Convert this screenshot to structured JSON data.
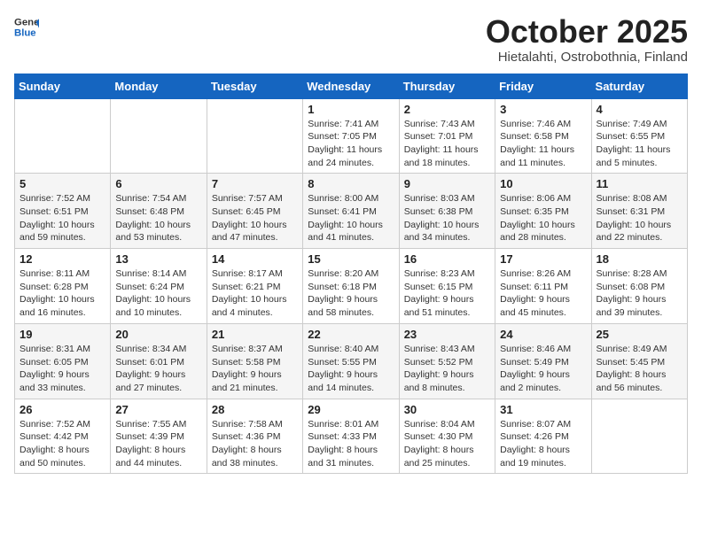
{
  "logo": {
    "general": "General",
    "blue": "Blue"
  },
  "header": {
    "month": "October 2025",
    "location": "Hietalahti, Ostrobothnia, Finland"
  },
  "weekdays": [
    "Sunday",
    "Monday",
    "Tuesday",
    "Wednesday",
    "Thursday",
    "Friday",
    "Saturday"
  ],
  "weeks": [
    [
      {
        "day": "",
        "info": ""
      },
      {
        "day": "",
        "info": ""
      },
      {
        "day": "",
        "info": ""
      },
      {
        "day": "1",
        "info": "Sunrise: 7:41 AM\nSunset: 7:05 PM\nDaylight: 11 hours\nand 24 minutes."
      },
      {
        "day": "2",
        "info": "Sunrise: 7:43 AM\nSunset: 7:01 PM\nDaylight: 11 hours\nand 18 minutes."
      },
      {
        "day": "3",
        "info": "Sunrise: 7:46 AM\nSunset: 6:58 PM\nDaylight: 11 hours\nand 11 minutes."
      },
      {
        "day": "4",
        "info": "Sunrise: 7:49 AM\nSunset: 6:55 PM\nDaylight: 11 hours\nand 5 minutes."
      }
    ],
    [
      {
        "day": "5",
        "info": "Sunrise: 7:52 AM\nSunset: 6:51 PM\nDaylight: 10 hours\nand 59 minutes."
      },
      {
        "day": "6",
        "info": "Sunrise: 7:54 AM\nSunset: 6:48 PM\nDaylight: 10 hours\nand 53 minutes."
      },
      {
        "day": "7",
        "info": "Sunrise: 7:57 AM\nSunset: 6:45 PM\nDaylight: 10 hours\nand 47 minutes."
      },
      {
        "day": "8",
        "info": "Sunrise: 8:00 AM\nSunset: 6:41 PM\nDaylight: 10 hours\nand 41 minutes."
      },
      {
        "day": "9",
        "info": "Sunrise: 8:03 AM\nSunset: 6:38 PM\nDaylight: 10 hours\nand 34 minutes."
      },
      {
        "day": "10",
        "info": "Sunrise: 8:06 AM\nSunset: 6:35 PM\nDaylight: 10 hours\nand 28 minutes."
      },
      {
        "day": "11",
        "info": "Sunrise: 8:08 AM\nSunset: 6:31 PM\nDaylight: 10 hours\nand 22 minutes."
      }
    ],
    [
      {
        "day": "12",
        "info": "Sunrise: 8:11 AM\nSunset: 6:28 PM\nDaylight: 10 hours\nand 16 minutes."
      },
      {
        "day": "13",
        "info": "Sunrise: 8:14 AM\nSunset: 6:24 PM\nDaylight: 10 hours\nand 10 minutes."
      },
      {
        "day": "14",
        "info": "Sunrise: 8:17 AM\nSunset: 6:21 PM\nDaylight: 10 hours\nand 4 minutes."
      },
      {
        "day": "15",
        "info": "Sunrise: 8:20 AM\nSunset: 6:18 PM\nDaylight: 9 hours\nand 58 minutes."
      },
      {
        "day": "16",
        "info": "Sunrise: 8:23 AM\nSunset: 6:15 PM\nDaylight: 9 hours\nand 51 minutes."
      },
      {
        "day": "17",
        "info": "Sunrise: 8:26 AM\nSunset: 6:11 PM\nDaylight: 9 hours\nand 45 minutes."
      },
      {
        "day": "18",
        "info": "Sunrise: 8:28 AM\nSunset: 6:08 PM\nDaylight: 9 hours\nand 39 minutes."
      }
    ],
    [
      {
        "day": "19",
        "info": "Sunrise: 8:31 AM\nSunset: 6:05 PM\nDaylight: 9 hours\nand 33 minutes."
      },
      {
        "day": "20",
        "info": "Sunrise: 8:34 AM\nSunset: 6:01 PM\nDaylight: 9 hours\nand 27 minutes."
      },
      {
        "day": "21",
        "info": "Sunrise: 8:37 AM\nSunset: 5:58 PM\nDaylight: 9 hours\nand 21 minutes."
      },
      {
        "day": "22",
        "info": "Sunrise: 8:40 AM\nSunset: 5:55 PM\nDaylight: 9 hours\nand 14 minutes."
      },
      {
        "day": "23",
        "info": "Sunrise: 8:43 AM\nSunset: 5:52 PM\nDaylight: 9 hours\nand 8 minutes."
      },
      {
        "day": "24",
        "info": "Sunrise: 8:46 AM\nSunset: 5:49 PM\nDaylight: 9 hours\nand 2 minutes."
      },
      {
        "day": "25",
        "info": "Sunrise: 8:49 AM\nSunset: 5:45 PM\nDaylight: 8 hours\nand 56 minutes."
      }
    ],
    [
      {
        "day": "26",
        "info": "Sunrise: 7:52 AM\nSunset: 4:42 PM\nDaylight: 8 hours\nand 50 minutes."
      },
      {
        "day": "27",
        "info": "Sunrise: 7:55 AM\nSunset: 4:39 PM\nDaylight: 8 hours\nand 44 minutes."
      },
      {
        "day": "28",
        "info": "Sunrise: 7:58 AM\nSunset: 4:36 PM\nDaylight: 8 hours\nand 38 minutes."
      },
      {
        "day": "29",
        "info": "Sunrise: 8:01 AM\nSunset: 4:33 PM\nDaylight: 8 hours\nand 31 minutes."
      },
      {
        "day": "30",
        "info": "Sunrise: 8:04 AM\nSunset: 4:30 PM\nDaylight: 8 hours\nand 25 minutes."
      },
      {
        "day": "31",
        "info": "Sunrise: 8:07 AM\nSunset: 4:26 PM\nDaylight: 8 hours\nand 19 minutes."
      },
      {
        "day": "",
        "info": ""
      }
    ]
  ]
}
